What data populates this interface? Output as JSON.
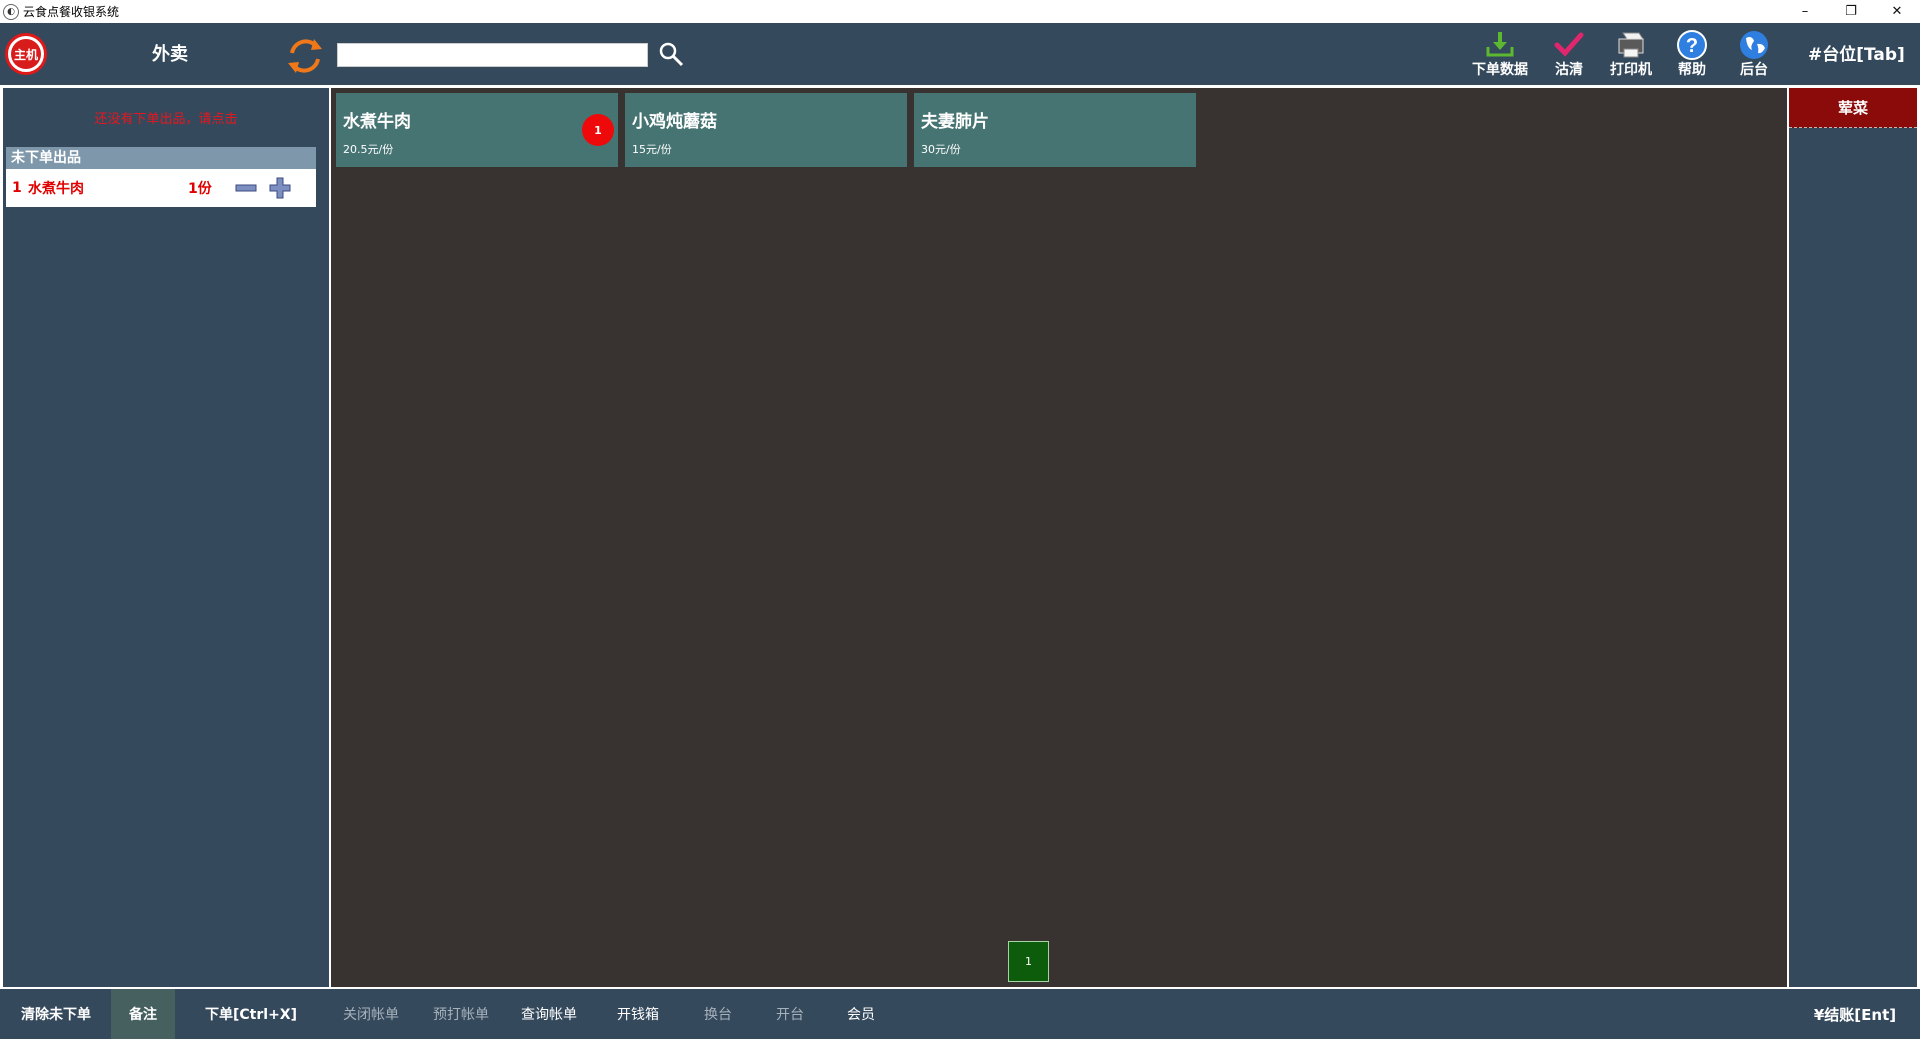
{
  "window": {
    "title": "云食点餐收银系统",
    "controls": [
      "–",
      "❐",
      "✕"
    ]
  },
  "toolbar": {
    "logo_text": "主机",
    "mode_label": "外卖",
    "search": {
      "value": "",
      "placeholder": ""
    },
    "tools": [
      {
        "label": "下单数据",
        "icon": "download-icon",
        "color": "#5cb82e"
      },
      {
        "label": "沽清",
        "icon": "checkmark-icon",
        "color": "#e0266d"
      },
      {
        "label": "打印机",
        "icon": "printer-icon",
        "color": "#dddddd"
      },
      {
        "label": "帮助",
        "icon": "help-icon",
        "color": "#2f7fe0"
      },
      {
        "label": "后台",
        "icon": "globe-icon",
        "color": "#2f7fe0"
      }
    ],
    "table_tab": "#台位[Tab]"
  },
  "left_panel": {
    "no_order_message": "还没有下单出品，请点击",
    "pending_header": "未下单出品",
    "pending_items": [
      {
        "index": "1",
        "name": "水煮牛肉",
        "qty": "1份"
      }
    ]
  },
  "dishes": [
    {
      "name": "水煮牛肉",
      "price": "20.5元/份",
      "badge": "1"
    },
    {
      "name": "小鸡炖蘑菇",
      "price": "15元/份",
      "badge": ""
    },
    {
      "name": "夫妻肺片",
      "price": "30元/份",
      "badge": ""
    }
  ],
  "pagination": {
    "current": "1"
  },
  "categories": [
    {
      "label": "荤菜"
    }
  ],
  "footer": {
    "clear_pending": "清除未下单",
    "remark": "备注",
    "place_order": "下单[Ctrl+X]",
    "close_bill": "关闭帐单",
    "preprint_bill": "预打帐单",
    "query_bill": "查询帐单",
    "open_cashbox": "开钱箱",
    "change_table": "换台",
    "open_table": "开台",
    "member": "会员",
    "checkout": "¥结账[Ent]"
  },
  "colors": {
    "toolbar_bg": "#34495c",
    "dish_card": "#467472",
    "dish_area": "#383330",
    "category_active": "#8b0a0a",
    "badge": "#ee0a0a",
    "alert_text": "#e8161e"
  }
}
